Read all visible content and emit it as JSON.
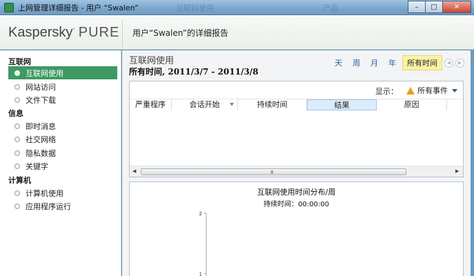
{
  "window": {
    "title": "上网管理详细报告 - 用户 “Swalen”",
    "ghost_text_1": "互联网使用",
    "ghost_text_2": "产品",
    "minimize": "–",
    "maximize": "□",
    "close": "✕"
  },
  "header": {
    "logo_brand": "Kaspersky",
    "logo_product": "PURE",
    "report_title": "用户“Swalen”的详细报告"
  },
  "sidebar": {
    "groups": [
      {
        "title": "互联网",
        "items": [
          {
            "label": "互联网使用",
            "active": true
          },
          {
            "label": "网站访问",
            "active": false
          },
          {
            "label": "文件下载",
            "active": false
          }
        ]
      },
      {
        "title": "信息",
        "items": [
          {
            "label": "即时消息",
            "active": false
          },
          {
            "label": "社交网络",
            "active": false
          },
          {
            "label": "隐私数据",
            "active": false
          },
          {
            "label": "关键字",
            "active": false
          }
        ]
      },
      {
        "title": "计算机",
        "items": [
          {
            "label": "计算机使用",
            "active": false
          },
          {
            "label": "应用程序运行",
            "active": false
          }
        ]
      }
    ]
  },
  "main": {
    "section_title": "互联网使用",
    "range_label": "所有时间, 2011/3/7 - 2011/3/8",
    "period_tabs": [
      {
        "label": "天",
        "active": false
      },
      {
        "label": "周",
        "active": false
      },
      {
        "label": "月",
        "active": false
      },
      {
        "label": "年",
        "active": false
      },
      {
        "label": "所有时间",
        "active": true
      }
    ],
    "filter": {
      "label": "显示：",
      "value": "所有事件"
    },
    "columns": [
      {
        "label": "严重程序"
      },
      {
        "label": "会话开始"
      },
      {
        "label": "持续时间"
      },
      {
        "label": "结果"
      },
      {
        "label": "原因"
      }
    ],
    "scrollbar_grip": "III"
  },
  "chart_data": {
    "type": "bar",
    "title": "互联网使用时间分布/周",
    "subtitle": "持续时间：00:00:00",
    "y_ticks": [
      "2",
      "1"
    ],
    "ylim": [
      0,
      2
    ],
    "categories": [],
    "series": []
  },
  "colors": {
    "accent_green": "#3f9a62",
    "active_tab_bg": "#fbf2a6",
    "link_blue": "#2b5f96"
  }
}
